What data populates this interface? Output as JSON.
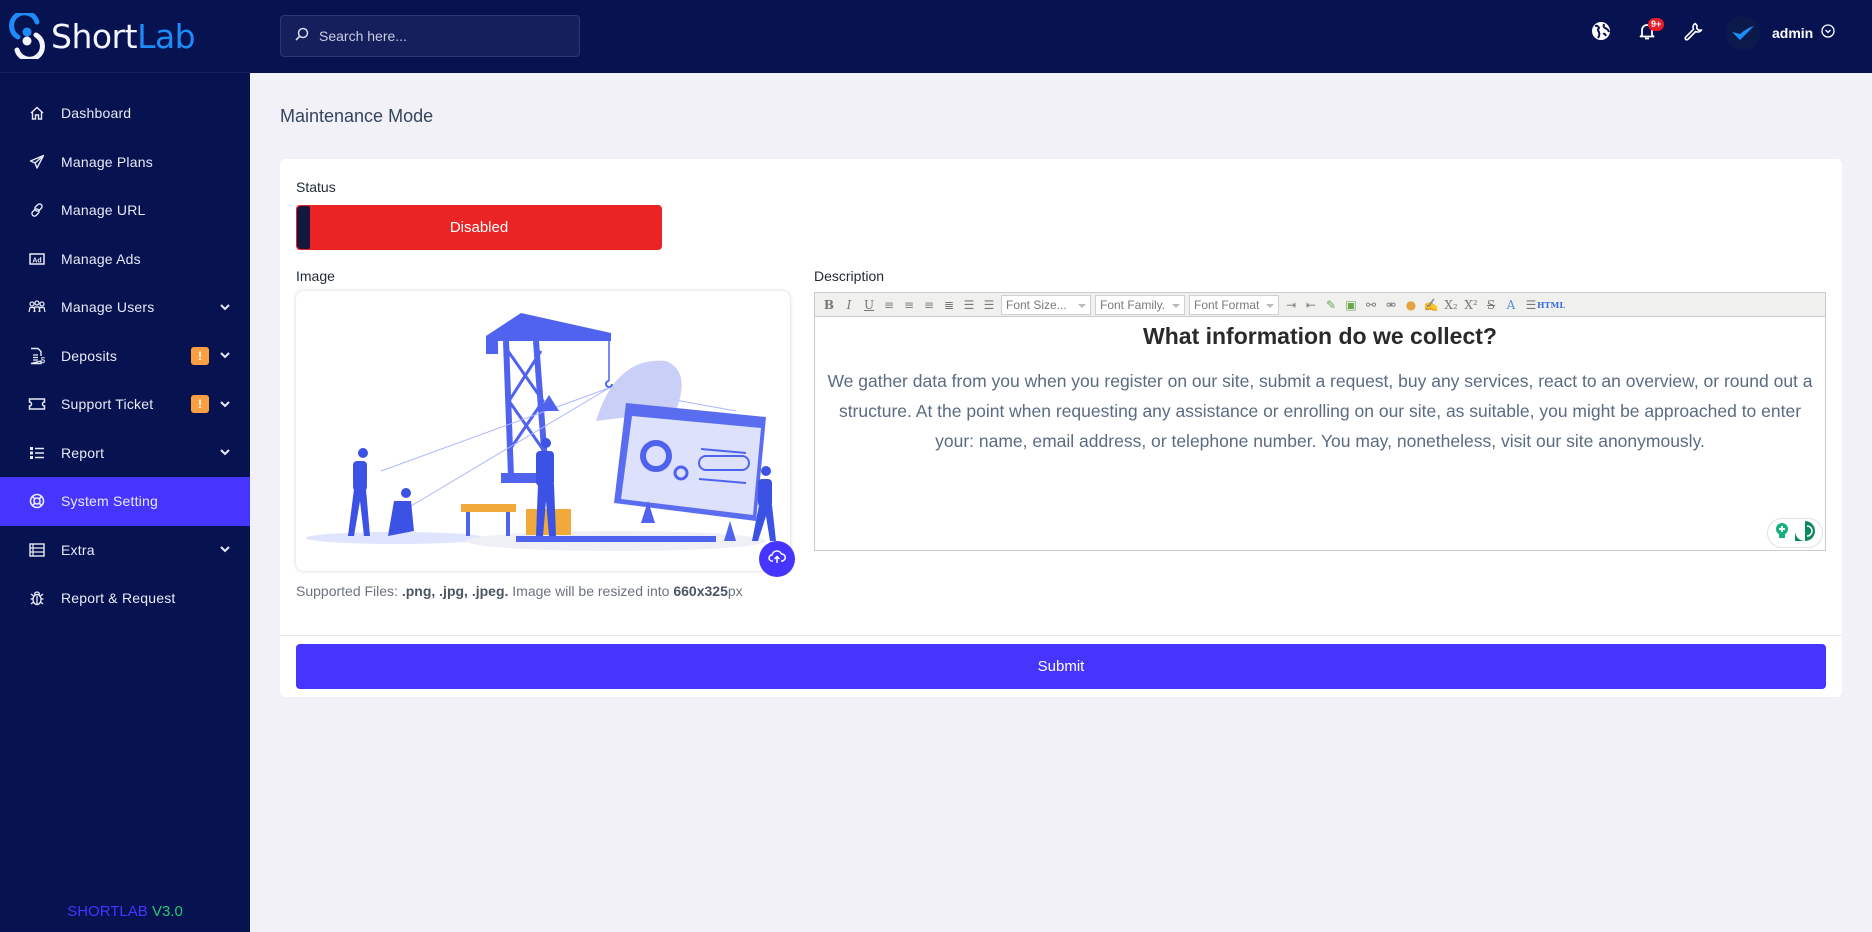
{
  "brand": {
    "name_part1": "Short",
    "name_part2": "Lab"
  },
  "sidebar": {
    "items": [
      {
        "label": "Dashboard",
        "icon": "home-icon"
      },
      {
        "label": "Manage Plans",
        "icon": "paper-plane-icon"
      },
      {
        "label": "Manage URL",
        "icon": "link-icon"
      },
      {
        "label": "Manage Ads",
        "icon": "ad-icon"
      },
      {
        "label": "Manage Users",
        "icon": "users-icon",
        "expandable": true
      },
      {
        "label": "Deposits",
        "icon": "invoice-dollar-icon",
        "badge": "!",
        "expandable": true
      },
      {
        "label": "Support Ticket",
        "icon": "ticket-icon",
        "badge": "!",
        "expandable": true
      },
      {
        "label": "Report",
        "icon": "list-icon",
        "expandable": true
      },
      {
        "label": "System Setting",
        "icon": "life-ring-icon",
        "active": true
      },
      {
        "label": "Extra",
        "icon": "server-icon",
        "expandable": true
      },
      {
        "label": "Report & Request",
        "icon": "bug-icon"
      }
    ],
    "version_name": "SHORTLAB",
    "version_number": "V3.0"
  },
  "topbar": {
    "search_placeholder": "Search here...",
    "notification_count": "9+",
    "user_name": "admin"
  },
  "page": {
    "title": "Maintenance Mode",
    "status_label": "Status",
    "status_value": "Disabled",
    "image_label": "Image",
    "hint_prefix": "Supported Files: ",
    "hint_types": ".png, .jpg, .jpeg.",
    "hint_middle": " Image will be resized into ",
    "hint_size": "660x325",
    "hint_suffix": "px",
    "description_label": "Description",
    "editor": {
      "font_size_placeholder": "Font Size...",
      "font_family_placeholder": "Font Family.",
      "font_format_placeholder": "Font Format",
      "heading": "What information do we collect?",
      "body": "We gather data from you when you register on our site, submit a request, buy any services, react to an overview, or round out a structure. At the point when requesting any assistance or enrolling on our site, as suitable, you might be approached to enter your: name, email address, or telephone number. You may, nonetheless, visit our site anonymously."
    },
    "submit_label": "Submit"
  },
  "colors": {
    "sidebar_bg": "#071251",
    "accent": "#4634ff",
    "status_disabled": "#ea2325",
    "badge_warning": "#ff9f43",
    "version_green": "#28c76f"
  }
}
